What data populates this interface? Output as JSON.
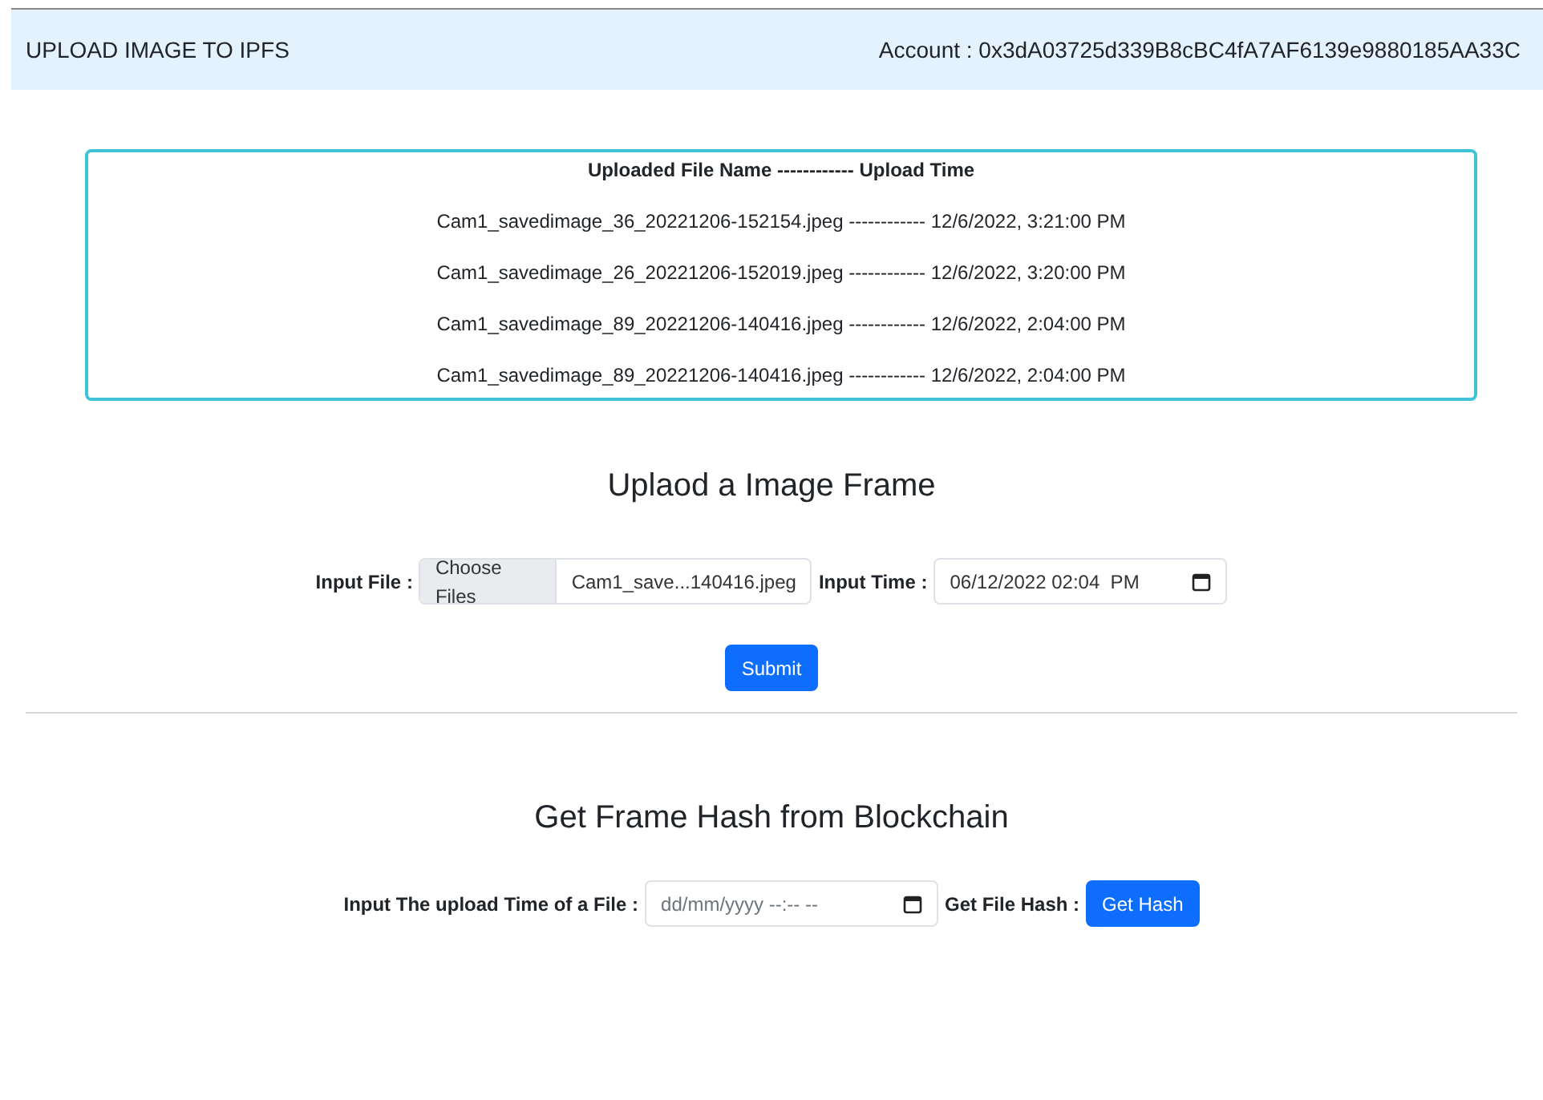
{
  "navbar": {
    "title": "UPLOAD IMAGE TO IPFS",
    "account": "Account : 0x3dA03725d339B8cBC4fA7AF6139e9880185AA33C"
  },
  "uploads": {
    "header": "Uploaded File Name ------------ Upload Time",
    "rows": [
      "Cam1_savedimage_36_20221206-152154.jpeg ------------ 12/6/2022, 3:21:00 PM",
      "Cam1_savedimage_26_20221206-152019.jpeg ------------ 12/6/2022, 3:20:00 PM",
      "Cam1_savedimage_89_20221206-140416.jpeg ------------ 12/6/2022, 2:04:00 PM",
      "Cam1_savedimage_89_20221206-140416.jpeg ------------ 12/6/2022, 2:04:00 PM"
    ]
  },
  "upload_form": {
    "heading": "Uplaod a Image Frame",
    "file_label": "Input File :",
    "file_button": "Choose Files",
    "file_name": "Cam1_save...140416.jpeg",
    "time_label": "Input Time :",
    "time_value": "06/12/2022 02:04  PM",
    "submit": "Submit"
  },
  "hash_form": {
    "heading": "Get Frame Hash from Blockchain",
    "time_label": "Input The upload Time of a File :",
    "time_placeholder": "dd/mm/yyyy --:-- --",
    "hash_label": "Get File Hash :",
    "button": "Get Hash"
  }
}
